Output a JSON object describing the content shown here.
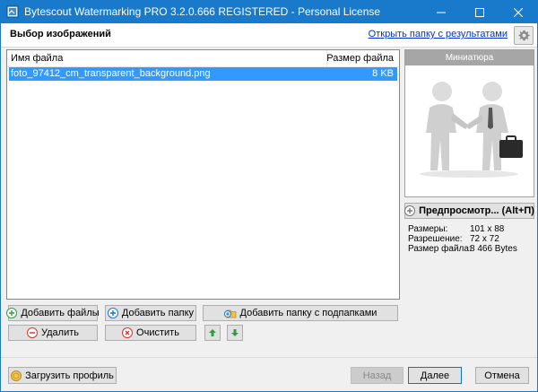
{
  "window": {
    "title": "Bytescout Watermarking PRO 3.2.0.666 REGISTERED - Personal License"
  },
  "header": {
    "title": "Выбор изображений",
    "open_results_link": "Открыть папку с результатами"
  },
  "file_list": {
    "columns": [
      "Имя файла",
      "Размер файла"
    ],
    "rows": [
      {
        "name": "foto_97412_cm_transparent_background.png",
        "size": "8 KB"
      }
    ]
  },
  "buttons": {
    "add_files": "Добавить файлы",
    "add_folder": "Добавить папку",
    "add_folder_subfolders": "Добавить папку с подпапками",
    "delete": "Удалить",
    "clear": "Очистить",
    "load_profile": "Загрузить профиль",
    "back": "Назад",
    "next": "Далее",
    "cancel": "Отмена",
    "preview": "Предпросмотр... (Alt+П)"
  },
  "thumbnail": {
    "title": "Миниатюра"
  },
  "properties": [
    {
      "label": "Размеры:",
      "value": "101 x 88"
    },
    {
      "label": "Разрешение:",
      "value": "72 x 72"
    },
    {
      "label": "Размер файла:",
      "value": "8 466 Bytes"
    }
  ],
  "colors": {
    "titlebar": "#1979ca",
    "selection": "#3399ff",
    "link": "#0033cc",
    "add_icon": "#2e9e3f",
    "remove_icon": "#d9302c",
    "info_icon": "#1a73c8"
  },
  "icons": {
    "app": "watermark-app-icon",
    "minimize": "minimize-icon",
    "maximize": "maximize-icon",
    "close": "close-icon",
    "settings": "gear-icon",
    "add": "plus-circle-icon",
    "remove": "minus-circle-icon",
    "clear": "cross-circle-icon",
    "move_up": "arrow-up-icon",
    "move_down": "arrow-down-icon",
    "load_profile": "coin-icon",
    "preview": "preview-icon"
  }
}
